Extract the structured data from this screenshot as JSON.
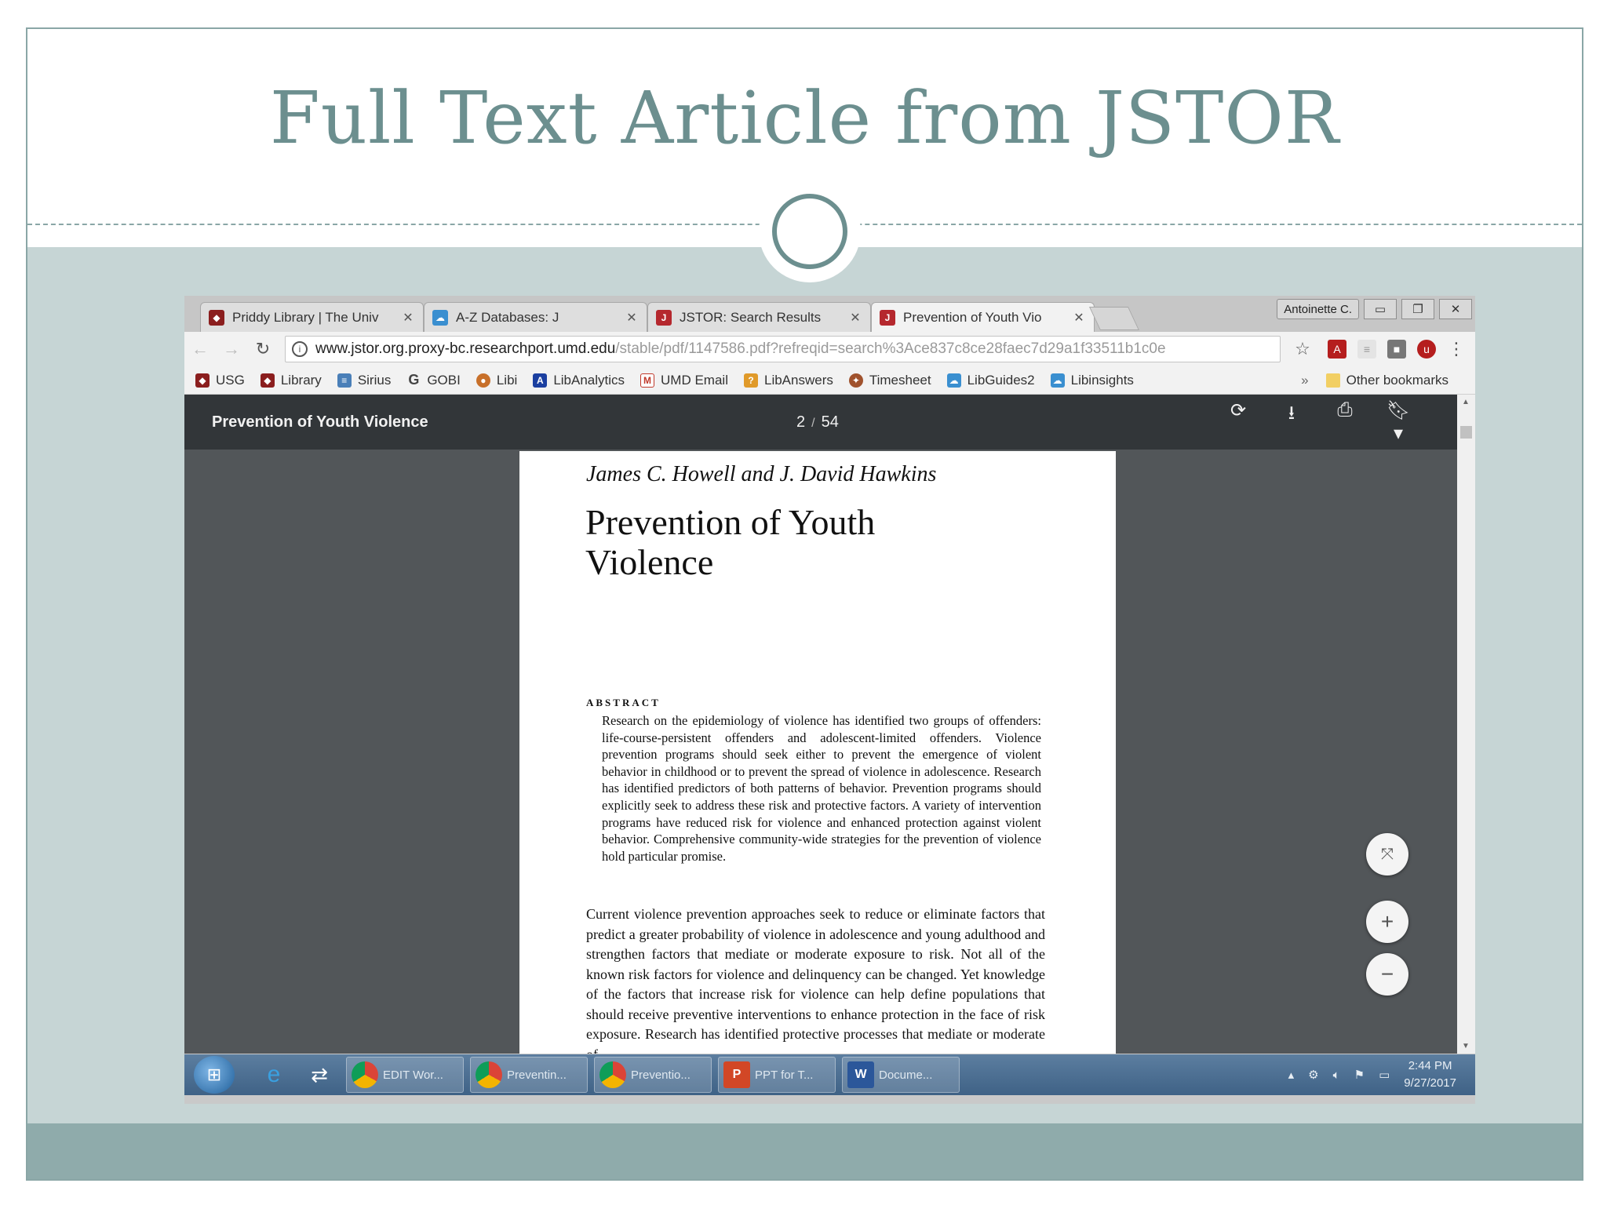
{
  "slide": {
    "title": "Full Text Article from JSTOR"
  },
  "colors": {
    "slide_accent": "#6c8f8f",
    "content_band": "#c6d5d5",
    "footer_band": "#8fabab",
    "pdf_toolbar": "#323639",
    "pdf_background": "#525659"
  },
  "browser": {
    "tabs": [
      {
        "label": "Priddy Library | The Univ",
        "icon": "library-shield-icon",
        "active": false
      },
      {
        "label": "A-Z Databases: J",
        "icon": "cloud-icon",
        "active": false
      },
      {
        "label": "JSTOR: Search Results",
        "icon": "jstor-icon",
        "active": false
      },
      {
        "label": "Prevention of Youth Vio",
        "icon": "jstor-icon",
        "active": true
      }
    ],
    "window_user": "Antoinette C.",
    "address": {
      "host": "www.jstor.org.proxy-bc.researchport.umd.edu",
      "path": "/stable/pdf/1147586.pdf?refreqid=search%3Ace837c8ce28faec7d29a1f33511b1c0e"
    },
    "bookmarks": [
      {
        "label": "USG",
        "color": "#8b1e1e"
      },
      {
        "label": "Library",
        "color": "#8b1e1e"
      },
      {
        "label": "Sirius",
        "color": "#4a7fb8"
      },
      {
        "label": "GOBI",
        "color": "#555555"
      },
      {
        "label": "Libi",
        "color": "#c8702a"
      },
      {
        "label": "LibAnalytics",
        "color": "#1b3fa0"
      },
      {
        "label": "UMD Email",
        "color": "#c0392b"
      },
      {
        "label": "LibAnswers",
        "color": "#e09a2a"
      },
      {
        "label": "Timesheet",
        "color": "#a0522d"
      },
      {
        "label": "LibGuides2",
        "color": "#3a8fd0"
      },
      {
        "label": "Libinsights",
        "color": "#3a8fd0"
      }
    ],
    "bookmarks_more": "»",
    "other_bookmarks": "Other bookmarks"
  },
  "pdf": {
    "title": "Prevention of Youth Violence",
    "page_current": "2",
    "page_separator": "/",
    "page_total": "54"
  },
  "page": {
    "authors": "James C. Howell and J. David Hawkins",
    "title": "Prevention of Youth Violence",
    "abstract_heading": "ABSTRACT",
    "abstract": "Research on the epidemiology of violence has identified two groups of offenders: life-course-persistent offenders and adolescent-limited offenders. Violence prevention programs should seek either to prevent the emergence of violent behavior in childhood or to prevent the spread of violence in adolescence. Research has identified predictors of both patterns of behavior. Prevention programs should explicitly seek to address these risk and protective factors. A variety of intervention programs have reduced risk for violence and enhanced protection against violent behavior. Comprehensive community-wide strategies for the prevention of violence hold particular promise.",
    "body": "Current violence prevention approaches seek to reduce or eliminate factors that predict a greater probability of violence in adolescence and young adulthood and strengthen factors that mediate or moderate exposure to risk. Not all of the known risk factors for violence and delinquency can be changed. Yet knowledge of the factors that increase risk for violence can help define populations that should receive preventive interventions to enhance protection in the face of risk exposure. Research has identified protective processes that mediate or moderate of"
  },
  "taskbar": {
    "items": [
      {
        "label": "EDIT Wor...",
        "icon": "chrome-icon"
      },
      {
        "label": "Preventin...",
        "icon": "chrome-icon"
      },
      {
        "label": "Preventio...",
        "icon": "chrome-icon"
      },
      {
        "label": "PPT for T...",
        "icon": "powerpoint-icon"
      },
      {
        "label": "Docume...",
        "icon": "word-icon"
      }
    ],
    "time": "2:44 PM",
    "date": "9/27/2017"
  }
}
